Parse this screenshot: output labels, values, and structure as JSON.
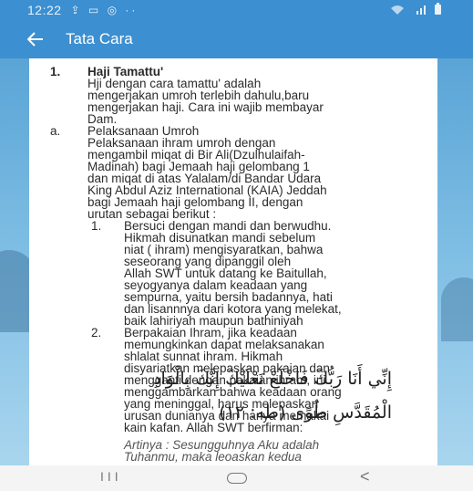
{
  "status_bar": {
    "time": "12:22",
    "notification_icons": "⇪ ▭ ◎ ··",
    "right_icons": "WiFi .ıl ▮"
  },
  "app_bar": {
    "back_icon": "arrow-left-icon",
    "title": "Tata Cara"
  },
  "content": {
    "item1_number": "1.",
    "item1_title": "Haji Tamattu'",
    "item1_lines": [
      "Hji dengan cara tamattu' adalah",
      "mengerjakan umroh terlebih dahulu,baru",
      "mengerjakan haji. Cara ini wajib membayar",
      "Dam."
    ],
    "sub_a_label": "a.",
    "sub_a_title": "Pelaksanaan Umroh",
    "sub_a_lines": [
      "Pelaksanaan ihram umroh dengan",
      "mengambil miqat di Bir Ali(Dzulhulaifah-",
      "Madinah) bagi Jemaah haji gelombang 1",
      "dan miqat di atas Yalalam/di Bandar Udara",
      "King Abdul Aziz International (KAIA) Jeddah",
      "bagi Jemaah haji gelombang II, dengan",
      "urutan sebagai berikut :"
    ],
    "step1_number": "1.",
    "step1_lines": [
      "Bersuci dengan mandi dan berwudhu.",
      "Hikmah disunatkan mandi sebelum",
      "niat ( ihram) mengisyaratkan, bahwa",
      "seseorang yang dipanggil oleh",
      "Allah SWT untuk datang ke Baitullah,",
      "seyogyanya dalam keadaan yang",
      "sempurna, yaitu bersih badannya, hati",
      "dan lisannnya dari kotora yang melekat,",
      "baik lahiriyah maupun bathiniyah"
    ],
    "step2_number": "2.",
    "step2_lines": [
      "Berpakaian Ihram, jika keadaan",
      "memungkinkan dapat melaksanakan",
      "shlalat sunnat ihram. Hikmah",
      "disyariatkan melepaskan pakaian dan",
      "mengganti dengan pakaian ihram, ini",
      "menggambarkan bahwa keadaan orang",
      "yang meninggal, harus melepaskan",
      "urusan dunianya dan hanya memakai",
      "kain kafan. Allah SWT berfirman:"
    ],
    "arabic_line1": "إِنِّي أَنَا رَبُّكَ فَاخْلَعْ نَعْلَيْكَ إِنَّكَ بِالْوَادِ",
    "arabic_line2": "الْمُقَدَّسِ طُوًى (طه: ١٢)",
    "translation_lines": [
      "Artinya : Sesungguhnya Aku adalah",
      "Tuhanmu, maka leoaskan kedua"
    ]
  },
  "nav_bar": {
    "recent_label": "III",
    "back_label": "<"
  }
}
